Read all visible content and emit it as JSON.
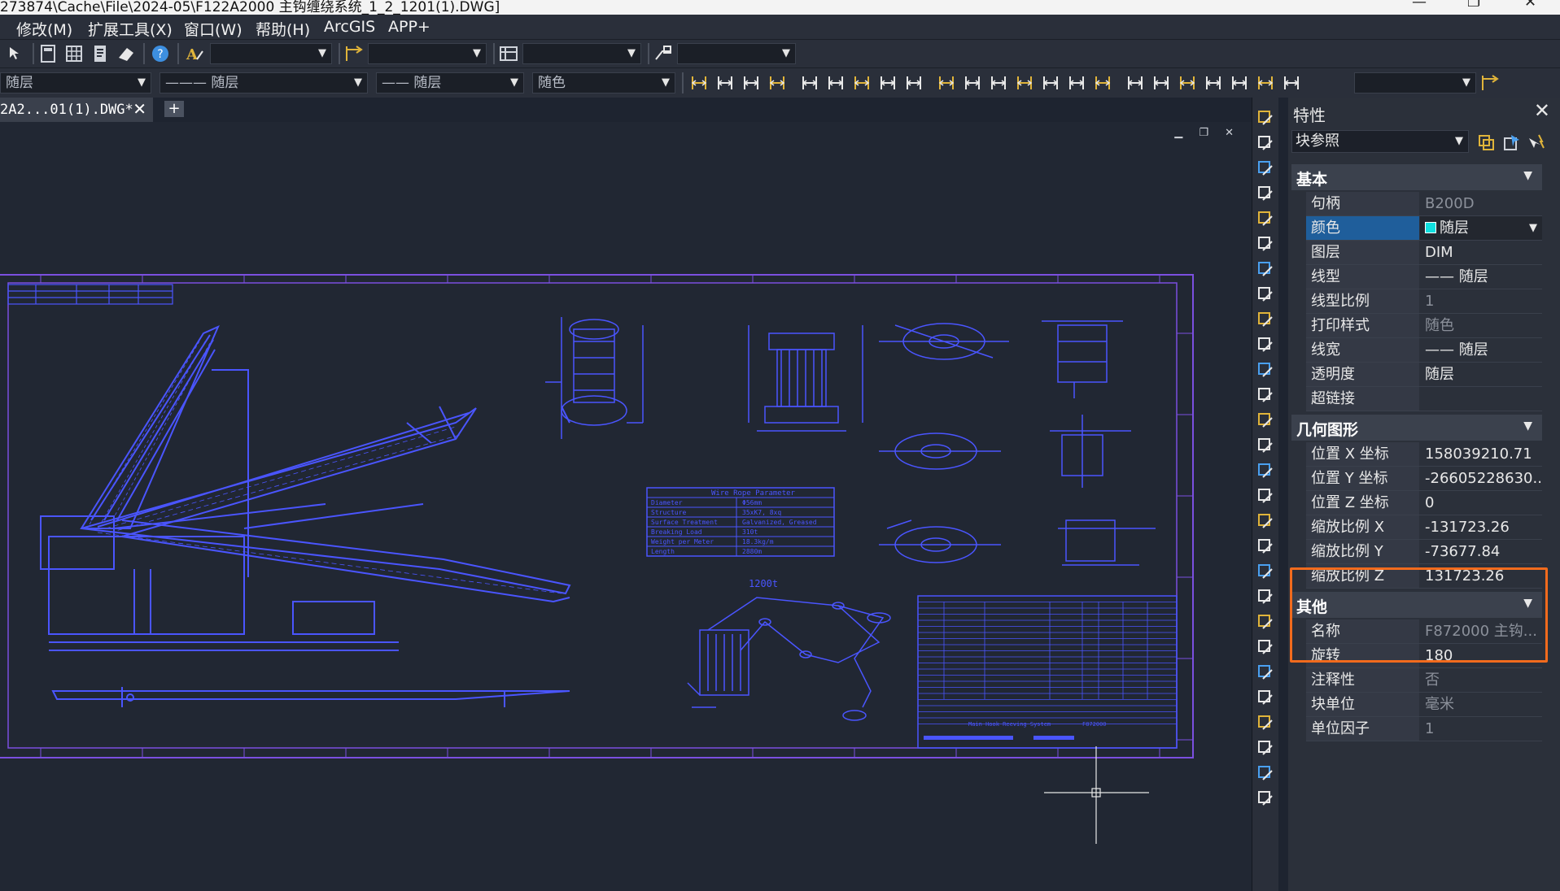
{
  "titlebar": {
    "path": "273874\\Cache\\File\\2024-05\\F122A2000 主钩缠绕系统_1_2_1201(1).DWG]"
  },
  "menu": [
    {
      "label": "修改(M)"
    },
    {
      "label": "扩展工具(X)"
    },
    {
      "label": "窗口(W)"
    },
    {
      "label": "帮助(H)"
    },
    {
      "label": "ArcGIS"
    },
    {
      "label": "APP+"
    }
  ],
  "toolbar2": {
    "layer": "随层",
    "linetype": "——— 随层",
    "lineweight": "—— 随层",
    "plotstyle": "随色"
  },
  "document_tab": {
    "label": "2A2...01(1).DWG*"
  },
  "drawing": {
    "rope_table_title": "Wire Rope Parameter",
    "rope_rows": [
      {
        "k": "Diameter",
        "v": "Φ56mm"
      },
      {
        "k": "Structure",
        "v": "35xK7, 8xq"
      },
      {
        "k": "Surface Treatment",
        "v": "Galvanized, Greased"
      },
      {
        "k": "Breaking Load",
        "v": "310t"
      },
      {
        "k": "Weight per Meter",
        "v": "18.3kg/m"
      },
      {
        "k": "Length",
        "v": "2880m"
      }
    ],
    "diagram_title": "1200t",
    "title_block_name": "Main Hook Reeving System",
    "drawing_no": "F872000"
  },
  "properties": {
    "title": "特性",
    "selected_type": "块参照",
    "sections": [
      {
        "title": "基本",
        "rows": [
          {
            "k": "句柄",
            "v": "B200D",
            "dim": true
          },
          {
            "k": "颜色",
            "v": "随层",
            "swatch": "#10e0e0",
            "selected": true
          },
          {
            "k": "图层",
            "v": "DIM"
          },
          {
            "k": "线型",
            "v": "—— 随层"
          },
          {
            "k": "线型比例",
            "v": "1",
            "dim": true
          },
          {
            "k": "打印样式",
            "v": "随色",
            "dim": true
          },
          {
            "k": "线宽",
            "v": "—— 随层"
          },
          {
            "k": "透明度",
            "v": "随层"
          },
          {
            "k": "超链接",
            "v": ""
          }
        ]
      },
      {
        "title": "几何图形",
        "rows": [
          {
            "k": "位置 X 坐标",
            "v": "158039210.71"
          },
          {
            "k": "位置 Y 坐标",
            "v": "-26605228630..."
          },
          {
            "k": "位置 Z 坐标",
            "v": "0"
          },
          {
            "k": "缩放比例 X",
            "v": "-131723.26"
          },
          {
            "k": "缩放比例 Y",
            "v": "-73677.84"
          },
          {
            "k": "缩放比例 Z",
            "v": "131723.26"
          }
        ]
      },
      {
        "title": "其他",
        "rows": [
          {
            "k": "名称",
            "v": "F872000 主钩...",
            "dim": true
          },
          {
            "k": "旋转",
            "v": "180"
          },
          {
            "k": "注释性",
            "v": "否",
            "dim": true
          },
          {
            "k": "块单位",
            "v": "毫米",
            "dim": true
          },
          {
            "k": "单位因子",
            "v": "1",
            "dim": true
          }
        ]
      }
    ]
  },
  "colors": {
    "drawing_line": "#4a55ff",
    "frame": "#7b4fe0",
    "highlight": "#f26b1d",
    "selected_row": "#1f5e9b"
  }
}
